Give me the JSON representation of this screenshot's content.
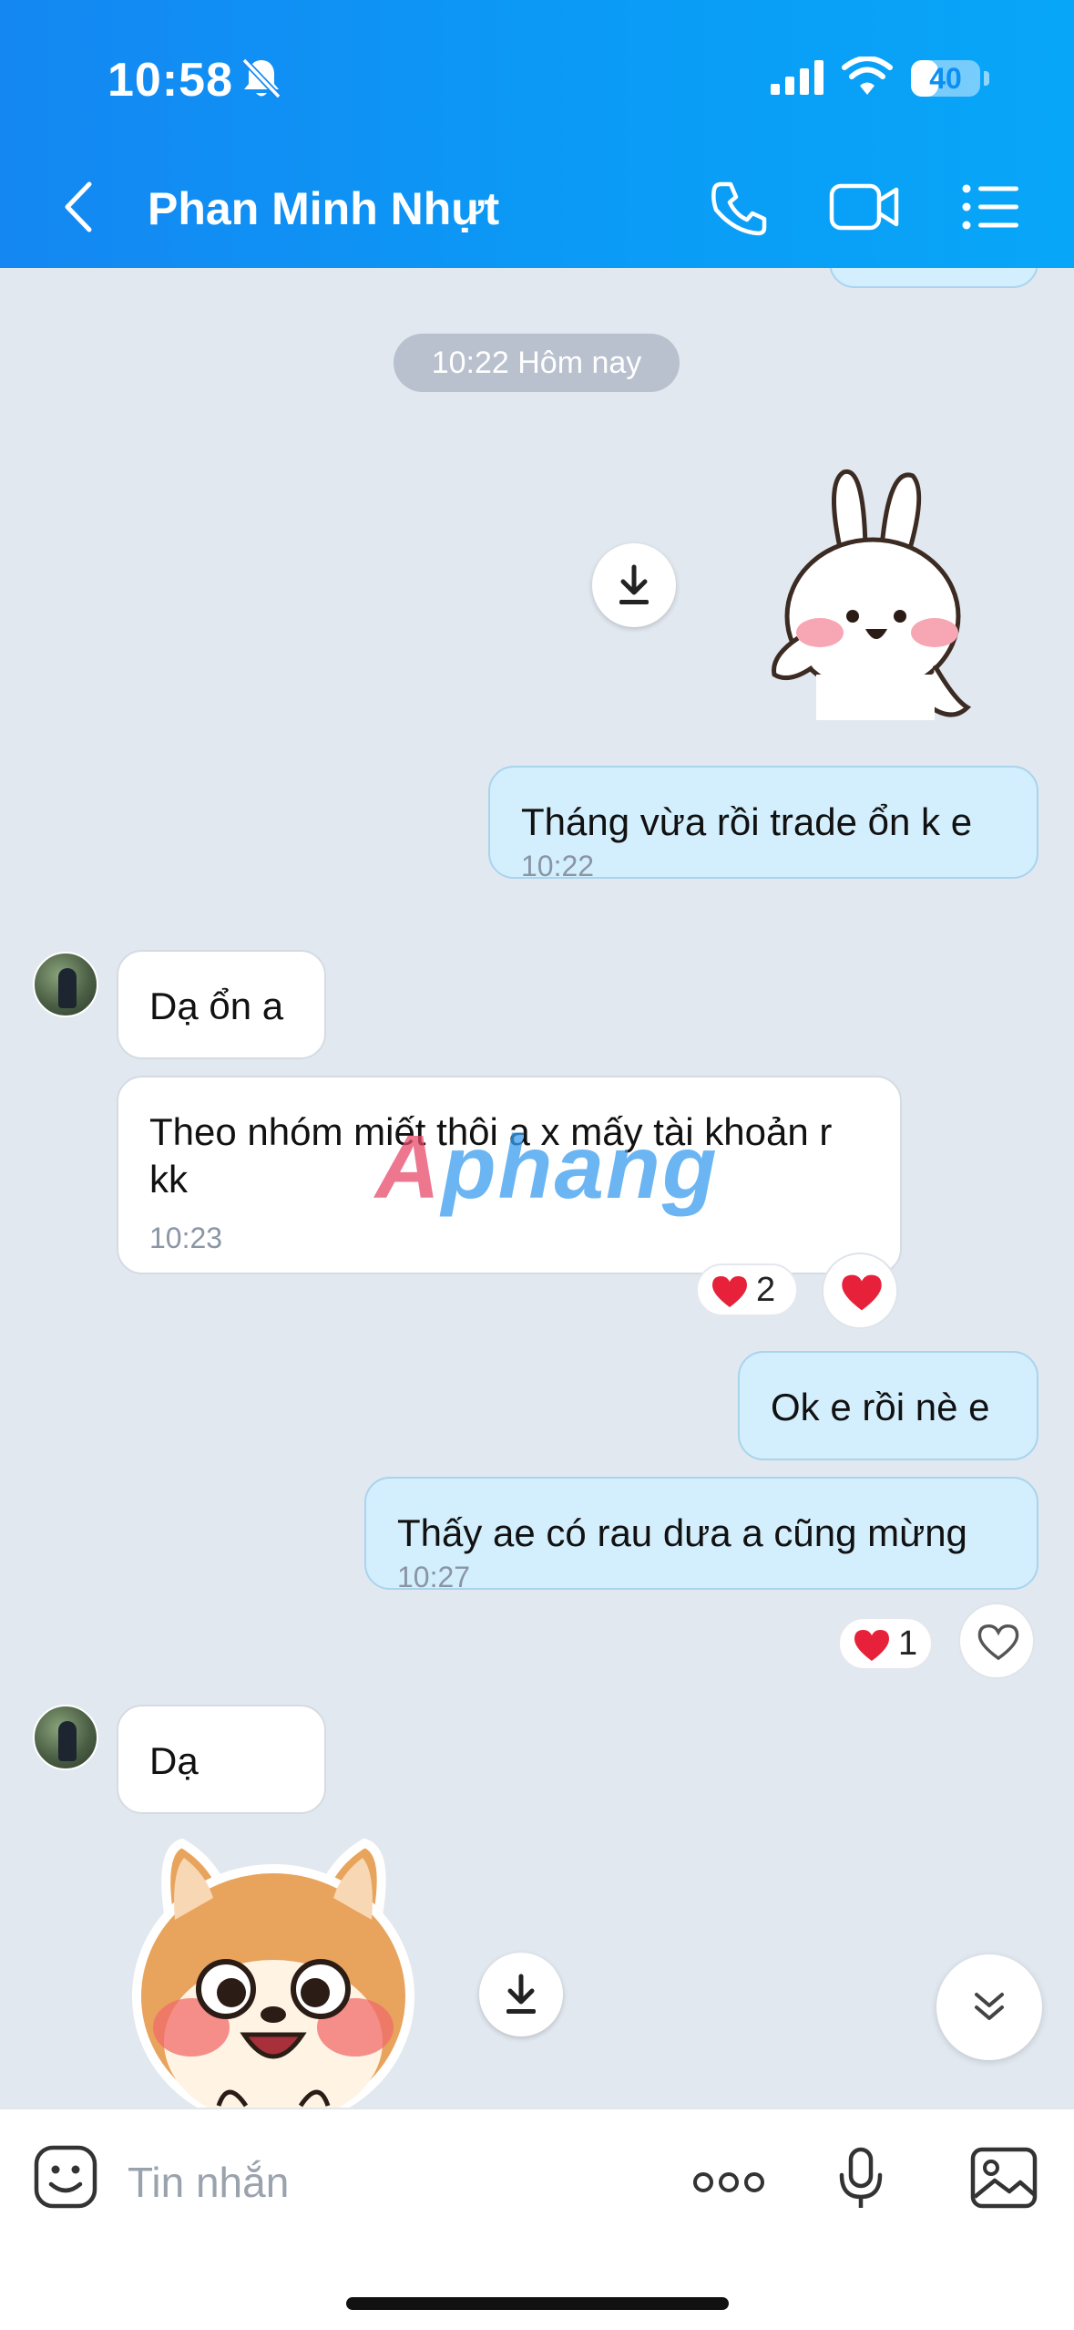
{
  "status_bar": {
    "time": "10:58",
    "battery_level": "40",
    "battery_fraction": 0.4
  },
  "header": {
    "contact_name": "Phan Minh Nhựt",
    "colors": {
      "gradient_start": "#1487f2",
      "gradient_end": "#08a6f8"
    }
  },
  "chat": {
    "date_separator": "10:22 Hôm nay",
    "messages": [
      {
        "sender": "me",
        "type": "sticker",
        "sticker": "bunny-waving"
      },
      {
        "sender": "me",
        "type": "text",
        "text": "Tháng vừa rồi trade ổn k e",
        "time": "10:22"
      },
      {
        "sender": "them",
        "type": "text",
        "text": "Dạ ổn a"
      },
      {
        "sender": "them",
        "type": "text",
        "text": "Theo nhóm miết thôi a x mấy tài khoản r kk",
        "time": "10:23",
        "reaction_count": "2"
      },
      {
        "sender": "me",
        "type": "text",
        "text": "Ok e rồi nè e"
      },
      {
        "sender": "me",
        "type": "text",
        "text": "Thấy ae có rau dưa a cũng mừng",
        "time": "10:27",
        "reaction_count": "1"
      },
      {
        "sender": "them",
        "type": "text",
        "text": "Dạ"
      },
      {
        "sender": "them",
        "type": "sticker",
        "sticker": "shiba-blushing"
      }
    ],
    "watermark": "Aphang"
  },
  "input": {
    "placeholder": "Tin nhắn"
  },
  "icons": {
    "back": "chevron-left-icon",
    "call": "phone-icon",
    "video": "video-camera-icon",
    "menu": "list-menu-icon",
    "download": "download-icon",
    "heart": "heart-icon",
    "sticker": "emoji-sticker-icon",
    "more": "more-dots-icon",
    "mic": "microphone-icon",
    "image": "image-icon",
    "scroll_down": "double-chevron-down-icon"
  },
  "colors": {
    "my_bubble": "#d3eefc",
    "their_bubble": "#ffffff",
    "chat_background": "#e2e8f0",
    "heart": "#e8213a"
  }
}
